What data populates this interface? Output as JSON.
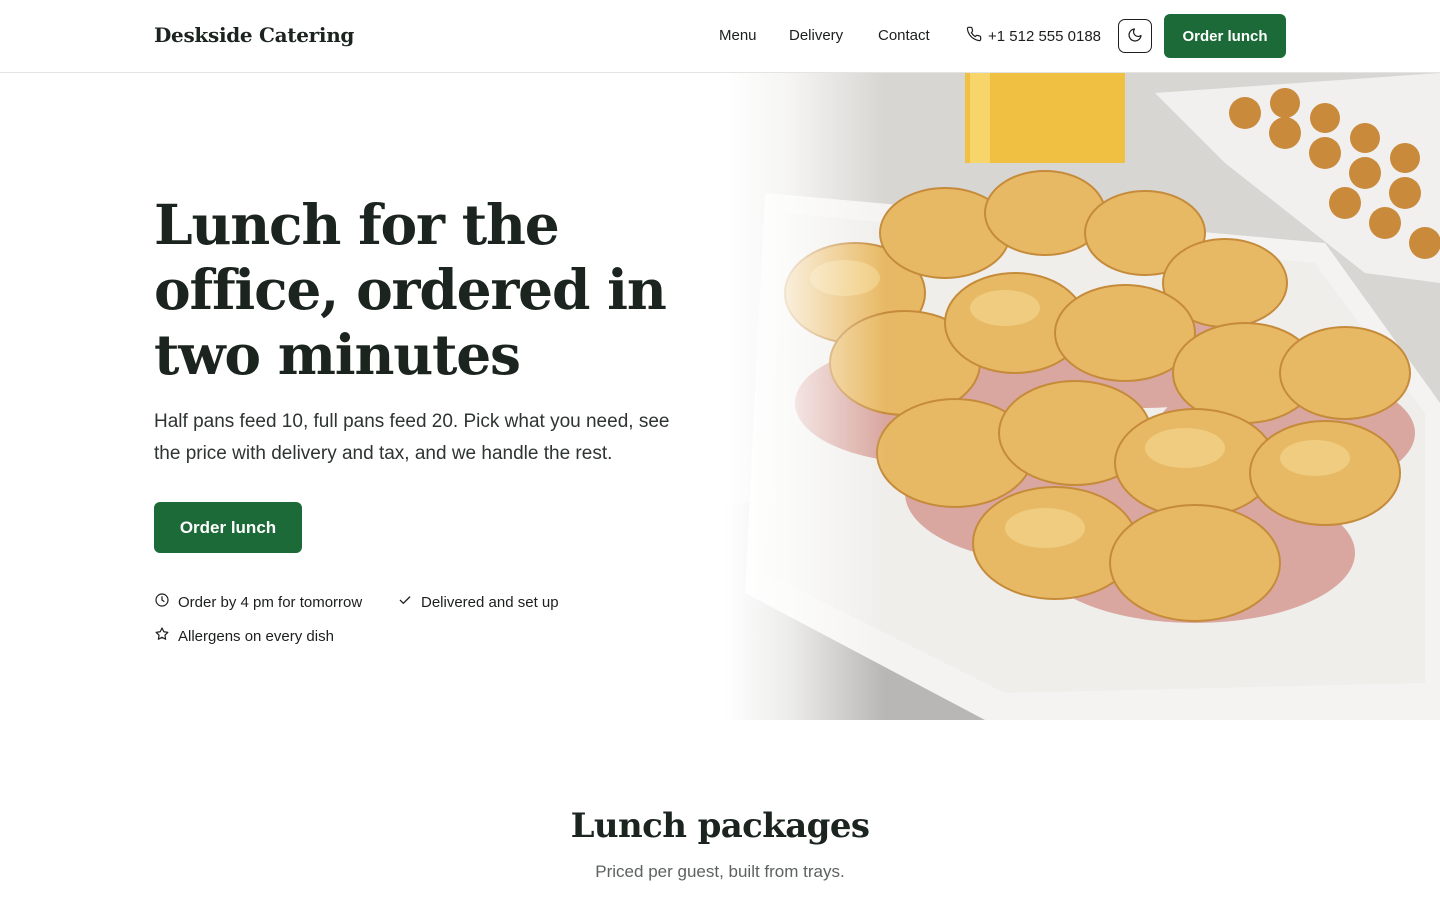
{
  "header": {
    "brand": "Deskside Catering",
    "nav": [
      "Menu",
      "Delivery",
      "Contact"
    ],
    "phone": "+1 512 555 0188",
    "cta_label": "Order lunch"
  },
  "hero": {
    "title": "Lunch for the office, ordered in two minutes",
    "subtitle": "Half pans feed 10, full pans feed 20. Pick what you need, see the price with delivery and tax, and we handle the rest.",
    "cta_label": "Order lunch",
    "features": [
      {
        "icon": "clock-icon",
        "text": "Order by 4 pm for tomorrow"
      },
      {
        "icon": "check-icon",
        "text": "Delivered and set up"
      },
      {
        "icon": "star-icon",
        "text": "Allergens on every dish"
      }
    ]
  },
  "packages": {
    "title": "Lunch packages",
    "subtitle": "Priced per guest, built from trays."
  },
  "colors": {
    "brand_green": "#1b6a38",
    "heading": "#1c2420"
  }
}
